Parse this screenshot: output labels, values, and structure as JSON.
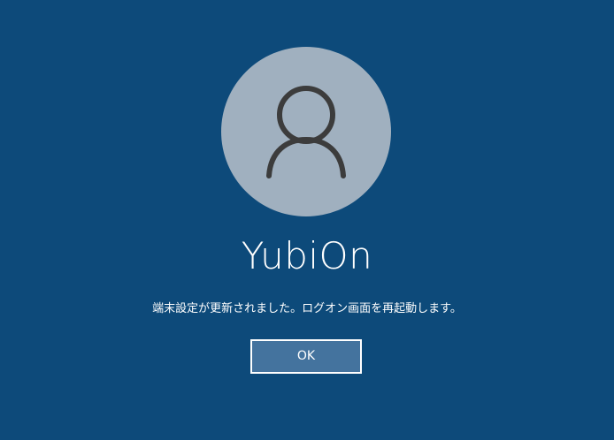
{
  "user": {
    "avatar_icon": "user-silhouette-icon",
    "name": "YubiOn"
  },
  "dialog": {
    "message": "端末設定が更新されました。ログオン画面を再起動します。",
    "ok_label": "OK"
  },
  "colors": {
    "background": "#0d4a7a",
    "avatar_circle": "#a0b0bf",
    "avatar_glyph": "#3c3c3c",
    "button_fill": "#44739e",
    "button_border": "#ffffff",
    "text": "#ffffff"
  }
}
